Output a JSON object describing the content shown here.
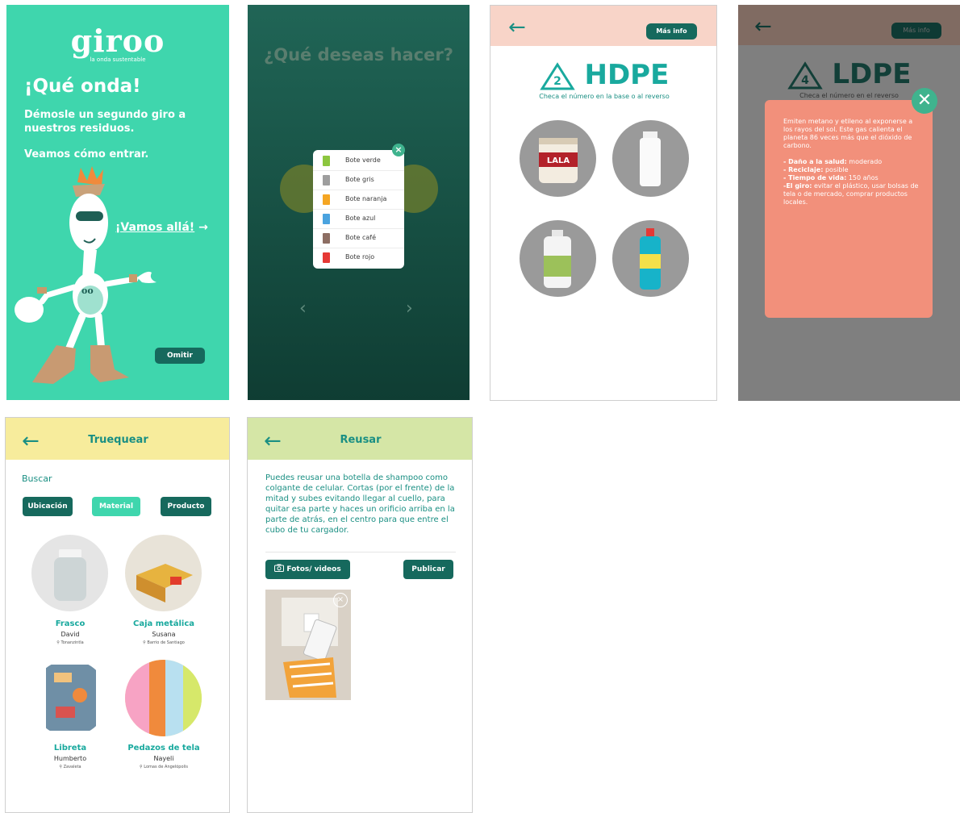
{
  "screen1": {
    "logo": "giroo",
    "tagline": "la onda sustentable",
    "greeting": "¡Qué onda!",
    "subtitle": "Démosle un segundo giro a nuestros residuos.",
    "enter_text": "Veamos cómo entrar.",
    "go_label": "¡Vamos allá!",
    "go_arrow": "→",
    "skip_label": "Omitir"
  },
  "screen2": {
    "question": "¿Qué deseas hacer?",
    "close_symbol": "×",
    "prev_arrow": "‹",
    "next_arrow": "›",
    "bins": [
      {
        "label": "Bote verde",
        "color": "#8cc63f"
      },
      {
        "label": "Bote gris",
        "color": "#9e9e9e"
      },
      {
        "label": "Bote naranja",
        "color": "#f5a623"
      },
      {
        "label": "Bote azul",
        "color": "#4aa3df"
      },
      {
        "label": "Bote café",
        "color": "#8d6e63"
      },
      {
        "label": "Bote rojo",
        "color": "#e53935"
      }
    ]
  },
  "screen3": {
    "back_arrow": "←",
    "more_info": "Más info",
    "recycle_number": "2",
    "title": "HDPE",
    "hint": "Checa el número en la base o al reverso",
    "products": [
      "LALA crema",
      "white bottle",
      "detergent bottle",
      "cleaner bottle"
    ]
  },
  "screen4": {
    "back_arrow": "←",
    "more_info": "Más info",
    "recycle_number": "4",
    "title": "LDPE",
    "hint": "Checa el número en el reverso",
    "close_symbol": "✕",
    "description": "Emiten metano y etileno al exponerse a los rayos del sol. Este gas calienta el planeta 86 veces más que el dióxido de carbono.",
    "facts": [
      {
        "label": "- Daño a la salud:",
        "value": " moderado"
      },
      {
        "label": "- Reciclaje:",
        "value": " posible"
      },
      {
        "label": "- Tiempo de vida:",
        "value": " 150 años"
      },
      {
        "label": "-El giro:",
        "value": " evitar el plástico, usar bolsas de tela o de mercado, comprar productos locales."
      }
    ]
  },
  "screen5": {
    "back_arrow": "←",
    "title": "Truequear",
    "search_placeholder": "Buscar",
    "chips": [
      "Ubicación",
      "Material",
      "Producto"
    ],
    "items": [
      {
        "title": "Frasco",
        "name": "David",
        "location": "⚲ Tonanzintla"
      },
      {
        "title": "Caja metálica",
        "name": "Susana",
        "location": "⚲ Barrio de Santiago"
      },
      {
        "title": "Libreta",
        "name": "Humberto",
        "location": "⚲ Zavaleta"
      },
      {
        "title": "Pedazos de tela",
        "name": "Nayeli",
        "location": "⚲ Lomas de Angelópolis"
      }
    ]
  },
  "screen6": {
    "back_arrow": "←",
    "title": "Reusar",
    "paragraph": "Puedes reusar una botella de shampoo como colgante de celular. Cortas (por el frente) de la mitad y subes evitando llegar al cuello, para quitar esa parte y haces un orificio arriba en la parte de atrás, en el centro para que entre el cubo de tu cargador.",
    "photos_label": "Fotos/ videos",
    "publish_label": "Publicar",
    "close_symbol": "×"
  },
  "colors": {
    "mint": "#3fd6ad",
    "dark_teal": "#16695d",
    "teal_text": "#1a8f83",
    "peach": "#f8d4c8",
    "salmon": "#f2907b",
    "yellow": "#f7ec9c",
    "light_green": "#d5e6a6"
  }
}
